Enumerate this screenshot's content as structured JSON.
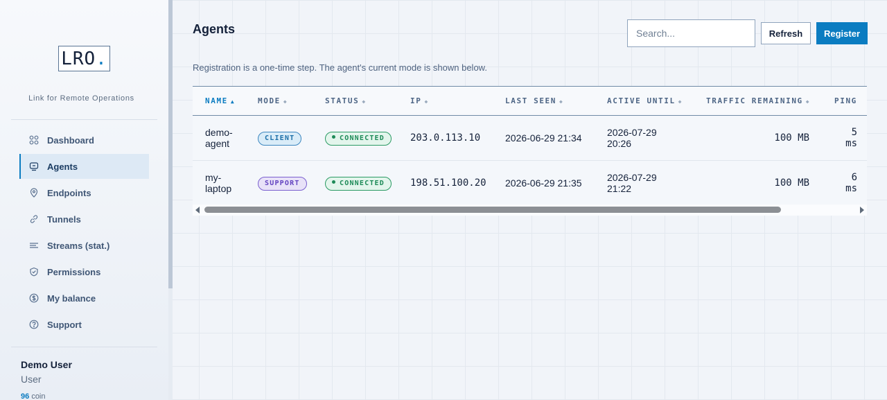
{
  "app": {
    "logo_text": "LRO",
    "logo_dot": ".",
    "tagline": "Link for Remote Operations"
  },
  "sidebar": {
    "items": [
      {
        "label": "Dashboard",
        "icon": "grid-icon",
        "active": false
      },
      {
        "label": "Agents",
        "icon": "agent-icon",
        "active": true
      },
      {
        "label": "Endpoints",
        "icon": "location-pin-icon",
        "active": false
      },
      {
        "label": "Tunnels",
        "icon": "link-icon",
        "active": false
      },
      {
        "label": "Streams (stat.)",
        "icon": "streams-icon",
        "active": false
      },
      {
        "label": "Permissions",
        "icon": "shield-icon",
        "active": false
      },
      {
        "label": "My balance",
        "icon": "dollar-icon",
        "active": false
      },
      {
        "label": "Support",
        "icon": "help-icon",
        "active": false
      }
    ]
  },
  "user": {
    "name": "Demo User",
    "role": "User",
    "balance": "96",
    "balance_unit": "coin"
  },
  "main": {
    "title": "Agents",
    "search_placeholder": "Search...",
    "refresh_label": "Refresh",
    "register_label": "Register",
    "note": "Registration is a one-time step. The agent's current mode is shown below."
  },
  "table": {
    "columns": [
      "NAME",
      "MODE",
      "STATUS",
      "IP",
      "LAST SEEN",
      "ACTIVE UNTIL",
      "TRAFFIC REMAINING",
      "PING"
    ],
    "sort_active": "▲",
    "sort_idle": "◆",
    "rows": [
      {
        "name_line1": "demo-",
        "name_line2": "agent",
        "mode": "CLIENT",
        "status": "CONNECTED",
        "ip": "203.0.113.10",
        "last_seen": "2026-06-29 21:34",
        "active_until_line1": "2026-07-29",
        "active_until_line2": "20:26",
        "traffic": "100 MB",
        "ping_line1": "5",
        "ping_line2": "ms"
      },
      {
        "name_line1": "my-",
        "name_line2": "laptop",
        "mode": "SUPPORT",
        "status": "CONNECTED",
        "ip": "198.51.100.20",
        "last_seen": "2026-06-29 21:35",
        "active_until_line1": "2026-07-29",
        "active_until_line2": "21:22",
        "traffic": "100 MB",
        "ping_line1": "6",
        "ping_line2": "ms"
      }
    ]
  },
  "colors": {
    "accent": "#0b7cc1",
    "client_pill": "#3b86bf",
    "support_pill": "#7a5fcf",
    "connected": "#1d8a57"
  }
}
